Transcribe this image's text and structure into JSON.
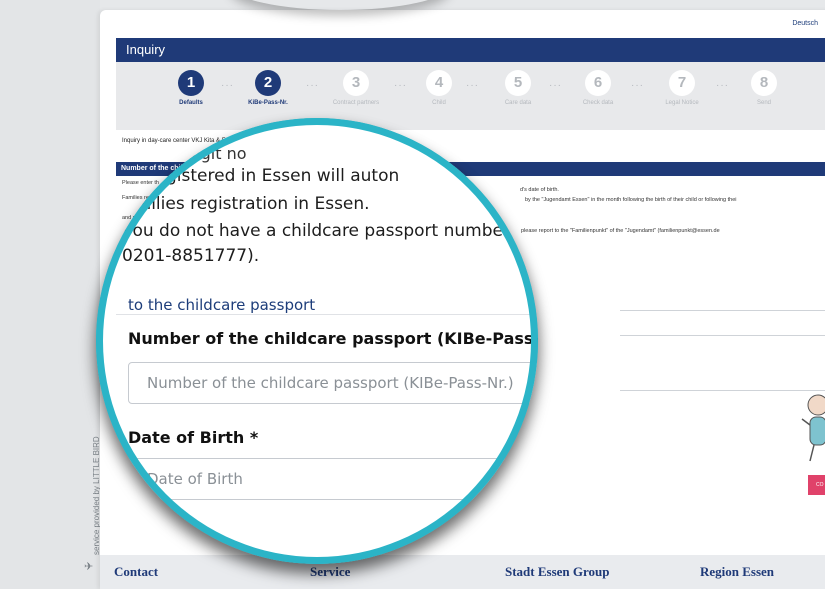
{
  "side_badge": {
    "text": "service provided by LITTLE BIRD",
    "icon": "little-bird-icon"
  },
  "header": {
    "language": "Deutsch",
    "inquiry_title": "Inquiry"
  },
  "steps": [
    {
      "number": "1",
      "label": "Defaults",
      "active": true
    },
    {
      "number": "2",
      "label": "KiBe-Pass-Nr.",
      "active": true
    },
    {
      "number": "3",
      "label": "Contract partners",
      "active": false
    },
    {
      "number": "4",
      "label": "Child",
      "active": false
    },
    {
      "number": "5",
      "label": "Care data",
      "active": false
    },
    {
      "number": "6",
      "label": "Check data",
      "active": false
    },
    {
      "number": "7",
      "label": "Legal Notice",
      "active": false
    },
    {
      "number": "8",
      "label": "Send",
      "active": false
    }
  ],
  "inquiry_line": "Inquiry in day-care center VKJ Kita & Familienzentrum Schmitzstr. \"Kinderhaus Himmelszelt\"",
  "section": {
    "title": "Number of the child",
    "line1": "Please enter th",
    "line1b": "d's date of birth.",
    "line2": "Families re",
    "line2b": "by the \"Jugendamt Essen\" in the month following the birth of their child or following thei",
    "line3": "and re",
    "line4b": "please report to the \"Familienpunkt\" of the \"Jugendamt\" (familienpunkt@essen.de"
  },
  "magnifier": {
    "top_fragment": "digit no",
    "line_registered": "gistered in Essen will auton",
    "line_registration": "Families registration in Essen.",
    "line_no_passport": "If you do not have a childcare passport numbe",
    "line_phone": "0201-8851777).",
    "link_passport": "to the childcare passport",
    "label_passport": "Number of the childcare passport (KIBe-Pass-Nr.)",
    "placeholder_passport": "Number of the childcare passport (KIBe-Pass-Nr.)",
    "label_dob": "Date of Birth *",
    "placeholder_dob": "Date of Birth"
  },
  "footer": {
    "items": [
      "Contact",
      "Service",
      "Stadt Essen Group",
      "Region Essen"
    ]
  },
  "pink_button": "CO",
  "colors": {
    "navy": "#1f3a78",
    "lens_ring": "#2bb4c7",
    "pink": "#e0426a"
  }
}
